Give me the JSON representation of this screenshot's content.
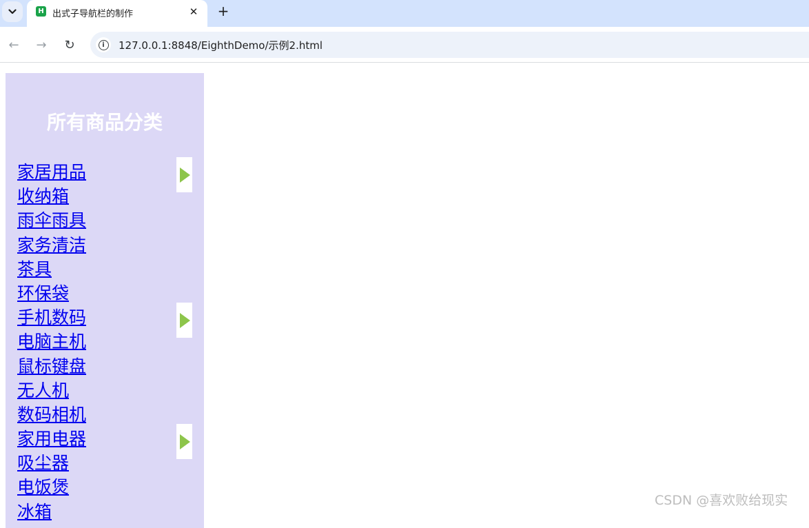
{
  "browser": {
    "tab_title": "出式子导航栏的制作",
    "tab_favicon_letter": "H",
    "close_glyph": "✕",
    "new_tab_glyph": "+",
    "url": "127.0.0.1:8848/EighthDemo/示例2.html",
    "back_glyph": "←",
    "forward_glyph": "→",
    "reload_glyph": "↻",
    "info_glyph": "i"
  },
  "page": {
    "heading": "所有商品分类",
    "menu_items": [
      {
        "label": "家居用品",
        "has_submenu": true
      },
      {
        "label": "收纳箱",
        "has_submenu": false
      },
      {
        "label": "雨伞雨具",
        "has_submenu": false
      },
      {
        "label": "家务清洁",
        "has_submenu": false
      },
      {
        "label": "茶具",
        "has_submenu": false
      },
      {
        "label": "环保袋",
        "has_submenu": false
      },
      {
        "label": "手机数码",
        "has_submenu": true
      },
      {
        "label": "电脑主机",
        "has_submenu": false
      },
      {
        "label": "鼠标键盘",
        "has_submenu": false
      },
      {
        "label": "无人机",
        "has_submenu": false
      },
      {
        "label": "数码相机",
        "has_submenu": false
      },
      {
        "label": "家用电器",
        "has_submenu": true
      },
      {
        "label": "吸尘器",
        "has_submenu": false
      },
      {
        "label": "电饭煲",
        "has_submenu": false
      },
      {
        "label": "冰箱",
        "has_submenu": false
      }
    ]
  },
  "colors": {
    "panel_bg": "#dcd8f6",
    "link": "#0000ee",
    "arrow": "#8dc54b"
  },
  "watermark": "CSDN @喜欢败给现实"
}
